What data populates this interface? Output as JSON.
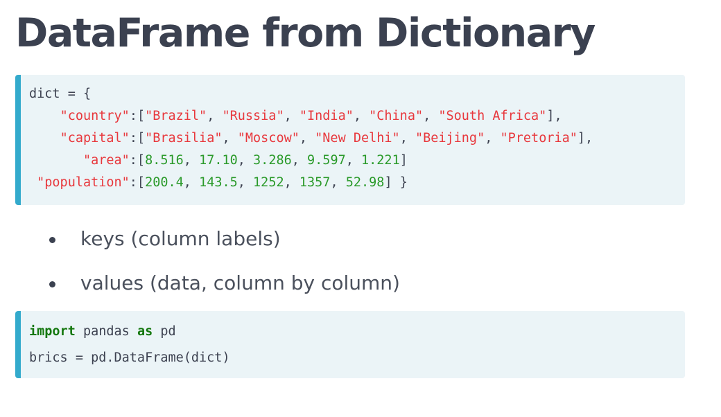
{
  "title": "DataFrame from Dictionary",
  "code_block_1": {
    "line1": {
      "p1": "dict = {"
    },
    "line2": {
      "indent": "    ",
      "key": "\"country\"",
      "s1": ":[",
      "v1": "\"Brazil\"",
      "c1": ", ",
      "v2": "\"Russia\"",
      "c2": ", ",
      "v3": "\"India\"",
      "c3": ", ",
      "v4": "\"China\"",
      "c4": ", ",
      "v5": "\"South Africa\"",
      "end": "],"
    },
    "line3": {
      "indent": "    ",
      "key": "\"capital\"",
      "s1": ":[",
      "v1": "\"Brasilia\"",
      "c1": ", ",
      "v2": "\"Moscow\"",
      "c2": ", ",
      "v3": "\"New Delhi\"",
      "c3": ", ",
      "v4": "\"Beijing\"",
      "c4": ", ",
      "v5": "\"Pretoria\"",
      "end": "],"
    },
    "line4": {
      "indent": "       ",
      "key": "\"area\"",
      "s1": ":[",
      "v1": "8.516",
      "c1": ", ",
      "v2": "17.10",
      "c2": ", ",
      "v3": "3.286",
      "c3": ", ",
      "v4": "9.597",
      "c4": ", ",
      "v5": "1.221",
      "end": "]"
    },
    "line5": {
      "indent": " ",
      "key": "\"population\"",
      "s1": ":[",
      "v1": "200.4",
      "c1": ", ",
      "v2": "143.5",
      "c2": ", ",
      "v3": "1252",
      "c3": ", ",
      "v4": "1357",
      "c4": ", ",
      "v5": "52.98",
      "end": "] }"
    }
  },
  "bullets": [
    "keys (column labels)",
    "values (data, column by column)"
  ],
  "code_block_2": {
    "line1": {
      "kw1": "import",
      "t1": " pandas ",
      "kw2": "as",
      "t2": " pd"
    },
    "line2": {
      "t1": "brics = pd.DataFrame(dict)"
    }
  },
  "colors": {
    "title": "#3b4150",
    "code_background": "#ebf4f7",
    "code_border": "#33aacc",
    "string": "#e8383d",
    "number": "#2a9a2a",
    "keyword": "#15780f"
  }
}
